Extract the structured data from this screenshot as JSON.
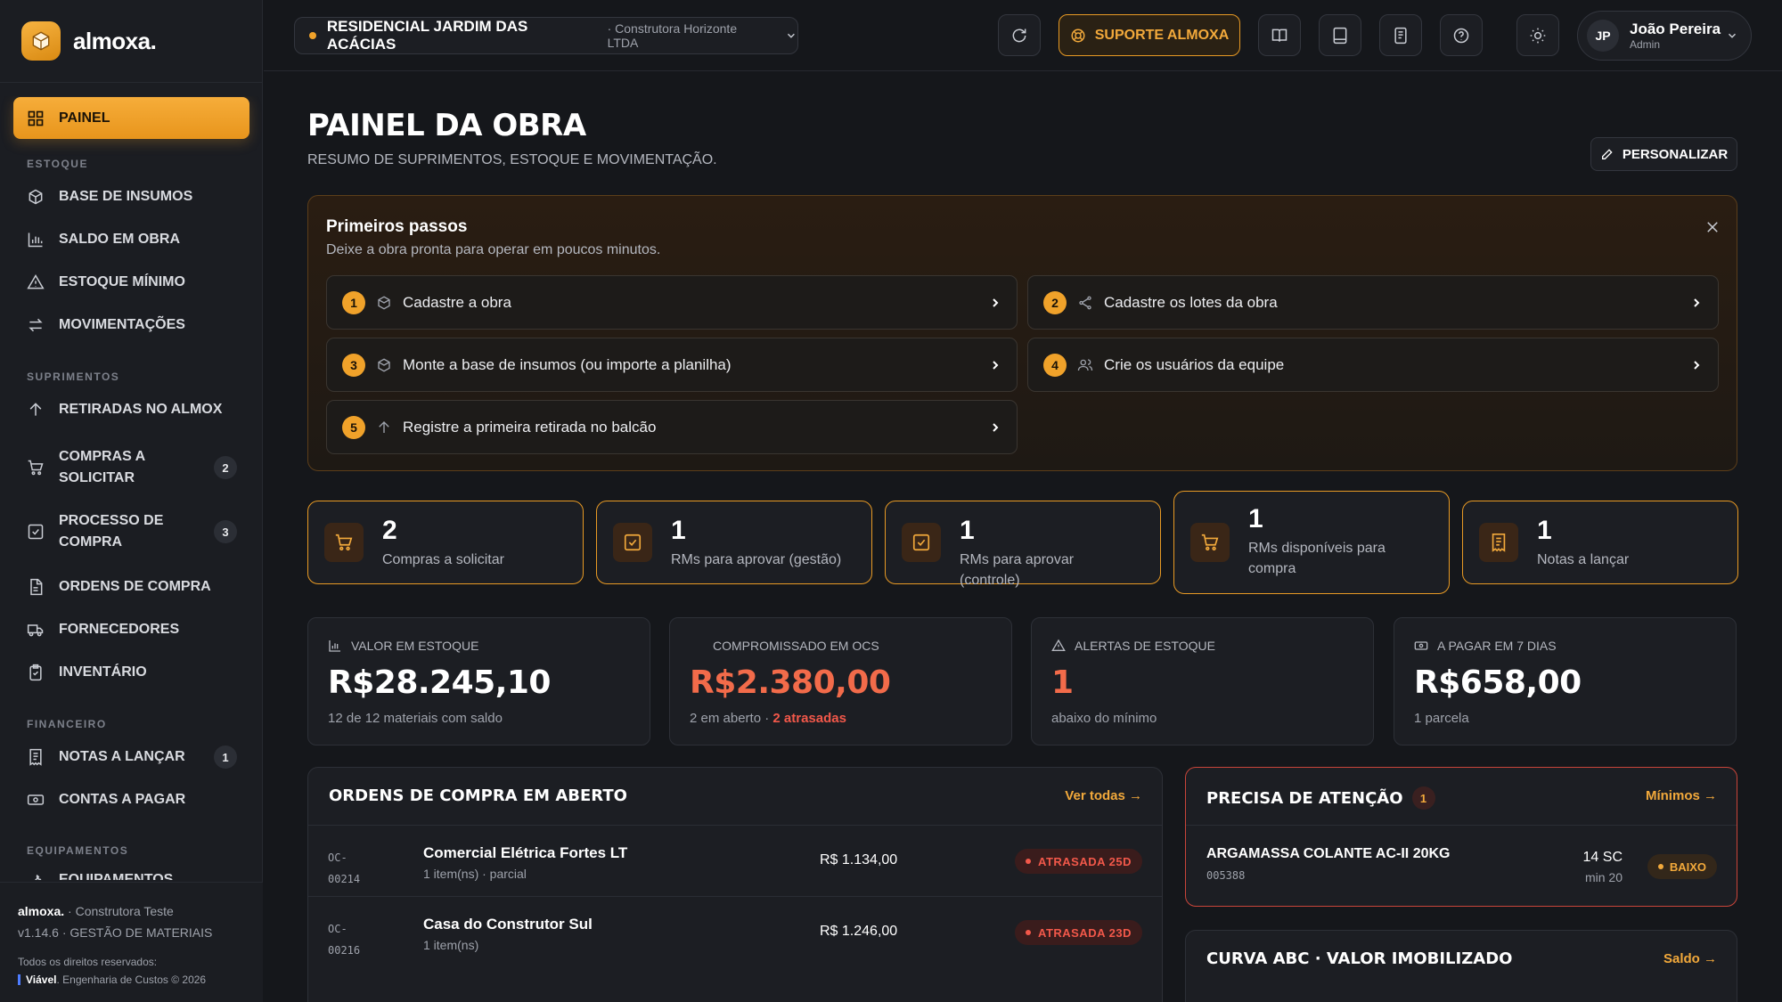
{
  "brand": {
    "name": "almoxa."
  },
  "sidebar": {
    "active_item": {
      "label": "PAINEL",
      "icon": "grid-icon"
    },
    "sections": [
      {
        "title": "ESTOQUE",
        "items": [
          {
            "label": "BASE DE INSUMOS",
            "icon": "box-icon"
          },
          {
            "label": "SALDO EM OBRA",
            "icon": "bar-chart-icon"
          },
          {
            "label": "ESTOQUE MÍNIMO",
            "icon": "warning-icon"
          },
          {
            "label": "MOVIMENTAÇÕES",
            "icon": "swap-icon"
          }
        ]
      },
      {
        "title": "SUPRIMENTOS",
        "items": [
          {
            "label": "RETIRADAS NO ALMOX",
            "icon": "arrow-up-icon"
          },
          {
            "label_line1": "COMPRAS A",
            "label_line2": "SOLICITAR",
            "badge": "2",
            "icon": "cart-icon"
          },
          {
            "label_line1": "PROCESSO DE",
            "label_line2": "COMPRA",
            "badge": "3",
            "icon": "checkbox-icon"
          },
          {
            "label": "ORDENS DE COMPRA",
            "icon": "document-icon"
          },
          {
            "label": "FORNECEDORES",
            "icon": "truck-icon"
          },
          {
            "label": "INVENTÁRIO",
            "icon": "clipboard-icon"
          }
        ]
      },
      {
        "title": "FINANCEIRO",
        "items": [
          {
            "label": "NOTAS A LANÇAR",
            "badge": "1",
            "icon": "receipt-icon"
          },
          {
            "label": "CONTAS A PAGAR",
            "icon": "cash-icon"
          }
        ]
      },
      {
        "title": "EQUIPAMENTOS",
        "items": [
          {
            "label": "EQUIPAMENTOS",
            "icon": "tool-icon"
          }
        ]
      }
    ],
    "footer": {
      "brand": "almoxa.",
      "company": "· Construtora Teste",
      "version": "v1.14.6 · GESTÃO DE MATERIAIS",
      "rights": "Todos os direitos reservados:",
      "maker_name": "Viável",
      "maker_rest": ". Engenharia de Custos © 2026"
    }
  },
  "topbar": {
    "project_name": "RESIDENCIAL JARDIM DAS ACÁCIAS",
    "project_company": "· Construtora Horizonte LTDA",
    "support_label": "SUPORTE ALMOXA",
    "icons": [
      "refresh-icon",
      "book-icon",
      "tablet-icon",
      "doc-icon",
      "help-icon",
      "sun-icon"
    ],
    "user": {
      "initials": "JP",
      "name": "João Pereira",
      "role": "Admin"
    }
  },
  "page": {
    "title": "PAINEL DA OBRA",
    "subtitle": "RESUMO DE SUPRIMENTOS, ESTOQUE E MOVIMENTAÇÃO.",
    "customize_label": "PERSONALIZAR"
  },
  "getting_started": {
    "title": "Primeiros passos",
    "subtitle": "Deixe a obra pronta para operar em poucos minutos.",
    "steps": [
      {
        "num": "1",
        "label": "Cadastre a obra",
        "icon": "box-icon"
      },
      {
        "num": "2",
        "label": "Cadastre os lotes da obra",
        "icon": "share-icon"
      },
      {
        "num": "3",
        "label": "Monte a base de insumos (ou importe a planilha)",
        "icon": "box-icon"
      },
      {
        "num": "4",
        "label": "Crie os usuários da equipe",
        "icon": "users-icon"
      },
      {
        "num": "5",
        "label": "Registre a primeira retirada no balcão",
        "icon": "arrow-up-icon"
      }
    ]
  },
  "kpis": [
    {
      "value": "2",
      "label": "Compras a solicitar",
      "icon": "cart-icon"
    },
    {
      "value": "1",
      "label": "RMs para aprovar (gestão)",
      "icon": "checkbox-icon"
    },
    {
      "value": "1",
      "label": "RMs para aprovar (controle)",
      "icon": "checkbox-icon"
    },
    {
      "value": "1",
      "label": "RMs disponíveis para compra",
      "icon": "cart-icon"
    },
    {
      "value": "1",
      "label": "Notas a lançar",
      "icon": "receipt-icon"
    }
  ],
  "stats": [
    {
      "title": "VALOR EM ESTOQUE",
      "value": "R$28.245,10",
      "foot": "12 de 12 materiais com saldo",
      "icon": "bar-chart-icon"
    },
    {
      "title": "COMPROMISSADO EM OCS",
      "value": "R$2.380,00",
      "foot": "2 em aberto · ",
      "foot_alert": "2 atrasadas",
      "icon": "none"
    },
    {
      "title": "ALERTAS DE ESTOQUE",
      "value": "1",
      "foot": "abaixo do mínimo",
      "icon": "warning-icon"
    },
    {
      "title": "A PAGAR EM 7 DIAS",
      "value": "R$658,00",
      "foot": "1 parcela",
      "icon": "cash-icon"
    }
  ],
  "open_orders": {
    "title": "ORDENS DE COMPRA EM ABERTO",
    "link": "Ver todas →",
    "rows": [
      {
        "code_a": "OC-",
        "code_b": "00214",
        "supplier": "Comercial Elétrica Fortes LT",
        "detail": "1 item(ns) · parcial",
        "amount": "R$ 1.134,00",
        "status": "ATRASADA 25D"
      },
      {
        "code_a": "OC-",
        "code_b": "00216",
        "supplier": "Casa do Construtor Sul",
        "detail": "1 item(ns)",
        "amount": "R$ 1.246,00",
        "status": "ATRASADA 23D"
      }
    ]
  },
  "attention": {
    "title": "PRECISA DE ATENÇÃO",
    "count": "1",
    "link": "Mínimos →",
    "item": {
      "name": "ARGAMASSA COLANTE AC-II 20KG",
      "code": "005388",
      "qty": "14 SC",
      "min": "min 20",
      "status": "BAIXO"
    }
  },
  "abc": {
    "title": "CURVA ABC · VALOR IMOBILIZADO",
    "link": "Saldo →"
  },
  "colors": {
    "accent": "#f0a22a",
    "danger": "#f2584a",
    "background": "#15171b",
    "surface": "#1c1e23"
  }
}
